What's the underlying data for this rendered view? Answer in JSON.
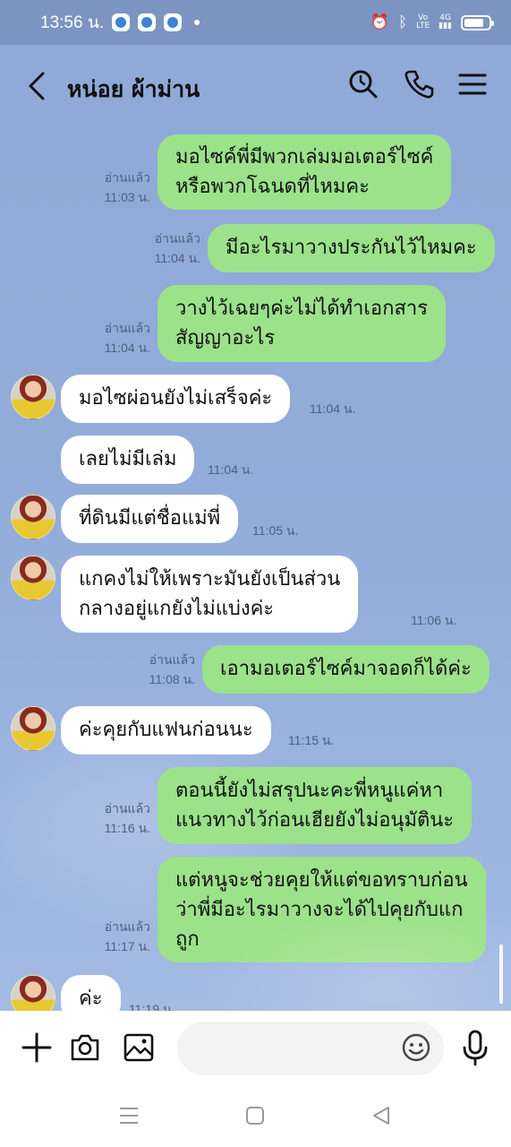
{
  "status_bar": {
    "time": "13:56 น.",
    "network": "4G",
    "battery_percent": 80
  },
  "header": {
    "title": "หน่อย ผ้าม่าน"
  },
  "messages": [
    {
      "side": "out",
      "lines": [
        "มอไซค์พี่มีพวกเล่มมอเตอร์ไซค์",
        "หรือพวกโฉนดที่ไหมคะ"
      ],
      "read": "อ่านแล้ว",
      "time": "11:03 น."
    },
    {
      "side": "out",
      "lines": [
        "มีอะไรมาวางประกันไว้ไหมคะ"
      ],
      "read": "อ่านแล้ว",
      "time": "11:04 น."
    },
    {
      "side": "out",
      "lines": [
        "วางไว้เฉยๆค่ะไม่ได้ทำเอกสาร",
        "สัญญาอะไร"
      ],
      "read": "อ่านแล้ว",
      "time": "11:04 น."
    },
    {
      "side": "in",
      "lines": [
        "มอไซผ่อนยังไม่เสร็จค่ะ"
      ],
      "time": "11:04 น."
    },
    {
      "side": "in",
      "lines": [
        "เลยไม่มีเล่ม"
      ],
      "time": "11:04 น."
    },
    {
      "side": "in",
      "lines": [
        "ที่ดินมีแต่ชื่อแม่พี่"
      ],
      "time": "11:05 น."
    },
    {
      "side": "in",
      "lines": [
        "แกคงไม่ให้เพราะมันยังเป็นส่วน",
        "กลางอยู่แกยังไม่แบ่งค่ะ"
      ],
      "time": "11:06 น."
    },
    {
      "side": "out",
      "lines": [
        "เอามอเตอร์ไซค์มาจอดก็ได้ค่ะ"
      ],
      "read": "อ่านแล้ว",
      "time": "11:08 น."
    },
    {
      "side": "in",
      "lines": [
        "ค่ะคุยกับแฟนก่อนนะ"
      ],
      "time": "11:15 น."
    },
    {
      "side": "out",
      "lines": [
        "ตอนนี้ยังไม่สรุปนะคะพี่หนูแค่หา",
        "แนวทางไว้ก่อนเฮียยังไม่อนุมัตินะ"
      ],
      "read": "อ่านแล้ว",
      "time": "11:16 น."
    },
    {
      "side": "out",
      "lines": [
        "แต่หนูจะช่วยคุยให้แต่ขอทราบก่อน",
        "ว่าพี่มีอะไรมาวางจะได้ไปคุยกับแก",
        "ถูก"
      ],
      "read": "อ่านแล้ว",
      "time": "11:17 น."
    },
    {
      "side": "in",
      "lines": [
        "ค่ะ"
      ],
      "time": "11:19 น."
    }
  ],
  "input": {
    "value": "",
    "placeholder": ""
  },
  "colors": {
    "chat_bg": "#8faad8",
    "outgoing_bubble": "#9be28a",
    "incoming_bubble": "#ffffff",
    "status_bar": "#7c94c2"
  },
  "icons": [
    "back-icon",
    "search-icon",
    "phone-icon",
    "menu-icon",
    "plus-icon",
    "camera-icon",
    "image-icon",
    "emoji-icon",
    "mic-icon"
  ]
}
